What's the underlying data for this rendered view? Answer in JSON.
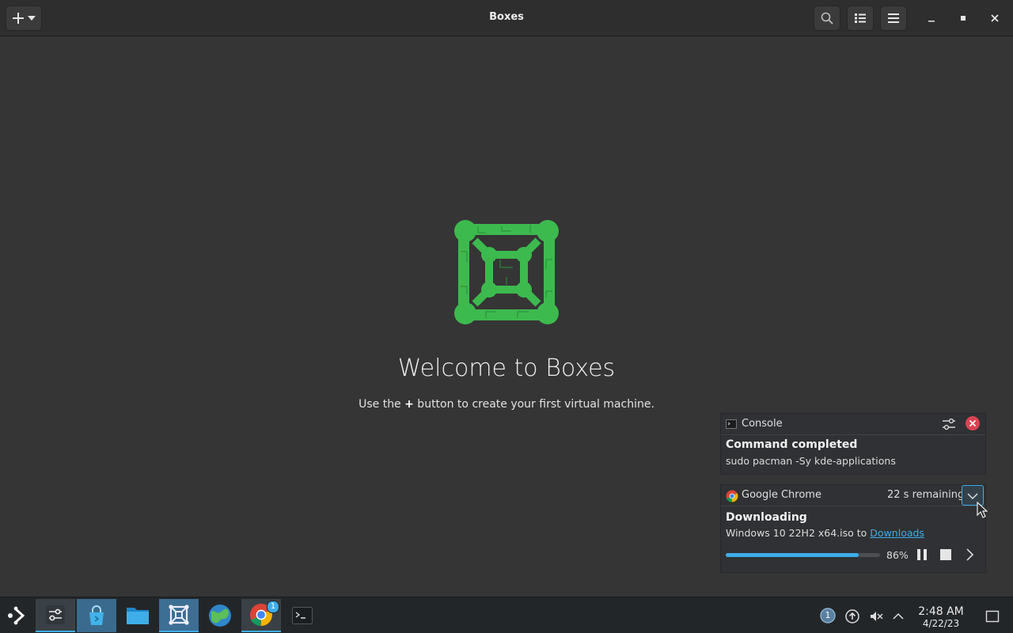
{
  "window": {
    "title": "Boxes",
    "buttons": {
      "new": "plus-icon",
      "search": "search-icon",
      "view": "list-view-icon",
      "menu": "hamburger-menu-icon",
      "minimize": "minimize-icon",
      "maximize": "maximize-icon",
      "close": "close-icon"
    }
  },
  "welcome": {
    "title": "Welcome to Boxes",
    "subtitle_pre": "Use the ",
    "subtitle_plus": "+",
    "subtitle_post": " button to create your first virtual machine."
  },
  "notifications": [
    {
      "app": "Console",
      "title": "Command completed",
      "body": "sudo pacman -Sy kde-applications"
    },
    {
      "app": "Google Chrome",
      "status": "22 s remaining",
      "title": "Downloading",
      "body_pre": "Windows 10 22H2 x64.iso to ",
      "body_link": "Downloads",
      "progress_percent": 86,
      "progress_label": "86%"
    }
  ],
  "taskbar": {
    "apps": [
      "application-launcher",
      "system-settings",
      "discover",
      "dolphin-file-manager",
      "gnome-boxes",
      "web-browser",
      "google-chrome",
      "konsole"
    ],
    "chrome_badge": "1",
    "tray_badge": "1",
    "time": "2:48 AM",
    "date": "4/22/23"
  },
  "colors": {
    "accent": "#3daee9",
    "boxes_logo": "#3dba4e",
    "close_notification": "#da4453"
  }
}
